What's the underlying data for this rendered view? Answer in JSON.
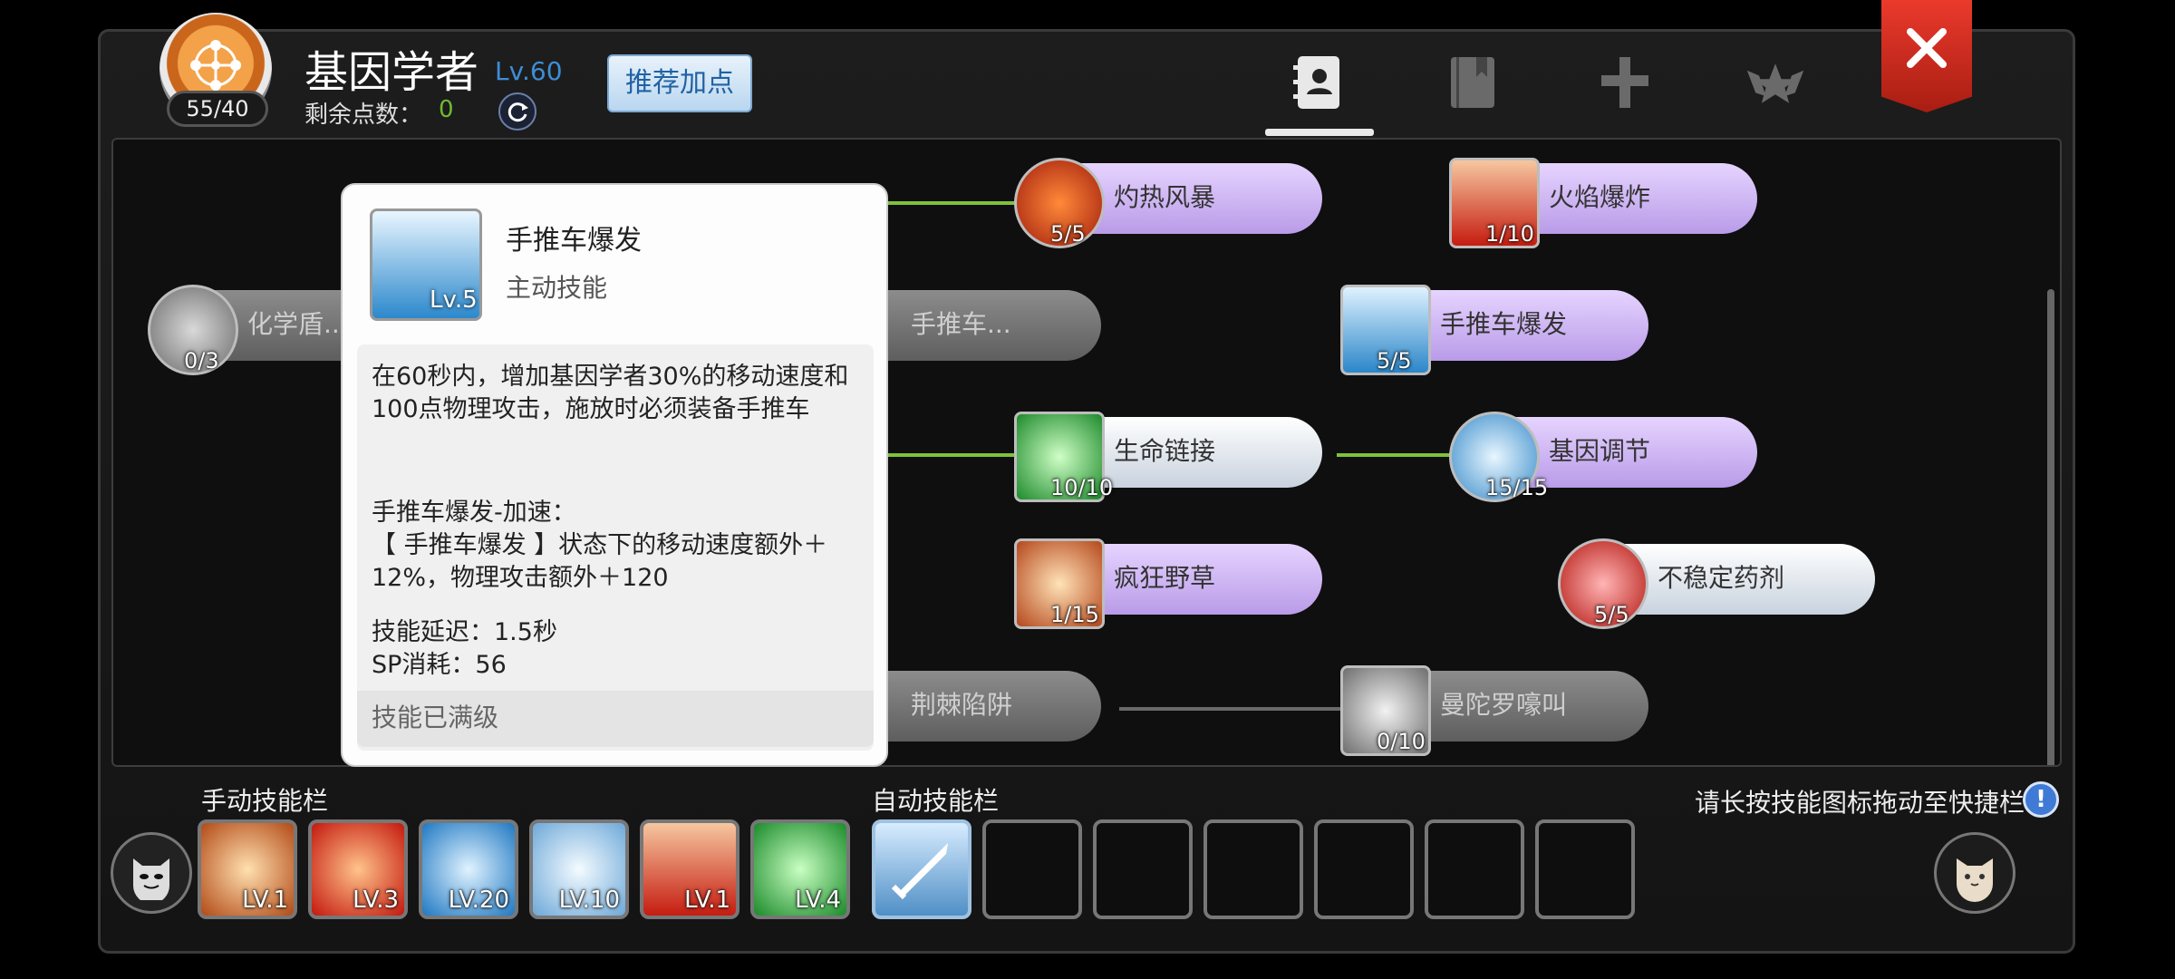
{
  "header": {
    "job_title": "基因学者",
    "job_level": "Lv.60",
    "job_points": "55/40",
    "remaining_label": "剩余点数：",
    "remaining_value": "0",
    "recommend_label": "推荐加点",
    "tabs": [
      "contacts-book-icon",
      "bookmark-book-icon",
      "cross-emblem-icon",
      "star-wings-icon"
    ],
    "active_tab": 0
  },
  "tree": {
    "nodes": [
      {
        "name": "灼热风暴",
        "count": "5/5"
      },
      {
        "name": "火焰爆炸",
        "count": "1/10"
      },
      {
        "name": "化学盾...",
        "count": "0/3"
      },
      {
        "name": "手推车...",
        "count": ""
      },
      {
        "name": "手推车爆发",
        "count": "5/5"
      },
      {
        "name": "生命链接",
        "count": "10/10"
      },
      {
        "name": "基因调节",
        "count": "15/15"
      },
      {
        "name": "疯狂野草",
        "count": "1/15"
      },
      {
        "name": "不稳定药剂",
        "count": "5/5"
      },
      {
        "name": "荆棘陷阱",
        "count": ""
      },
      {
        "name": "曼陀罗嚎叫",
        "count": "0/10"
      }
    ]
  },
  "tooltip": {
    "name": "手推车爆发",
    "level": "Lv.5",
    "type": "主动技能",
    "description": "在60秒内，增加基因学者30%的移动速度和100点物理攻击，施放时必须装备手推车",
    "extra_title": "手推车爆发-加速：",
    "extra_text": "【 手推车爆发 】状态下的移动速度额外＋12%，物理攻击额外＋120",
    "delay": "技能延迟：1.5秒",
    "sp_cost": "SP消耗：56",
    "max_text": "技能已满级"
  },
  "manual_bar": {
    "label": "手动技能栏",
    "slots": [
      "LV.1",
      "LV.3",
      "LV.20",
      "LV.10",
      "LV.1",
      "LV.4"
    ]
  },
  "auto_bar": {
    "label": "自动技能栏"
  },
  "hint": "请长按技能图标拖动至快捷栏",
  "colors": {
    "accent_blue": "#3e8dd6",
    "points_green": "#6dbb2e",
    "close_red": "#d9281b",
    "link_green": "#7fc13c"
  }
}
